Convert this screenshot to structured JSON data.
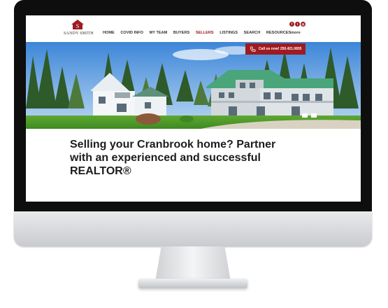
{
  "site": {
    "logo_text": "SANDY SMITH",
    "nav": {
      "items": [
        "HOME",
        "COVID INFO",
        "MY TEAM",
        "BUYERS",
        "SELLERS",
        "LISTINGS",
        "SEARCH",
        "RESOURCES"
      ],
      "active": "SELLERS"
    },
    "social_icons": [
      "facebook-icon",
      "twitter-icon",
      "instagram-icon"
    ],
    "more_label": "more",
    "call_button": "Call us now! 250.421.0835",
    "headline": "Selling your Cranbrook home? Partner with an experienced and successful REALTOR®"
  },
  "colors": {
    "brand": "#9e1b20",
    "bezel": "#0e0e0e",
    "text": "#1d1d1d"
  }
}
